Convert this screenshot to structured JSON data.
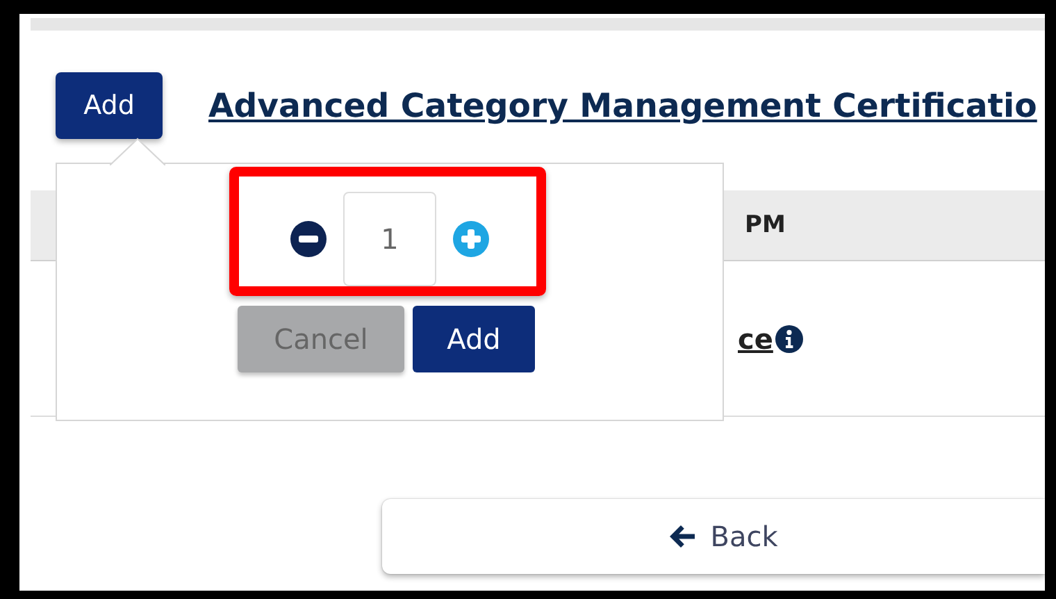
{
  "add_button": {
    "label": "Add"
  },
  "course_title": "Advanced Category Management Certificatio",
  "table": {
    "header_text": "PM",
    "row_link": "ce"
  },
  "popover": {
    "quantity": "1",
    "buttons": [
      {
        "label": "Cancel",
        "kind": "cancel"
      },
      {
        "label": "Add",
        "kind": "primary"
      }
    ]
  },
  "back_button": {
    "label": "Back"
  }
}
